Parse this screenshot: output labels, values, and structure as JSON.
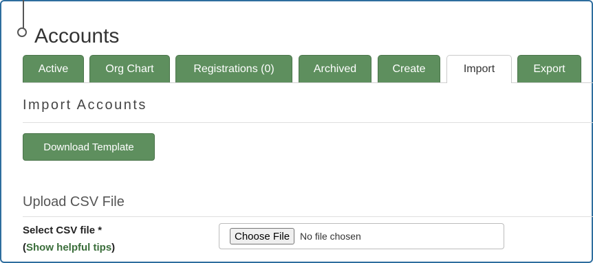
{
  "page": {
    "title": "Accounts"
  },
  "tabs": [
    {
      "label": "Active",
      "active": false
    },
    {
      "label": "Org Chart",
      "active": false
    },
    {
      "label": "Registrations (0)",
      "active": false
    },
    {
      "label": "Archived",
      "active": false
    },
    {
      "label": "Create",
      "active": false
    },
    {
      "label": "Import",
      "active": true
    },
    {
      "label": "Export",
      "active": false
    }
  ],
  "import_section": {
    "heading": "Import Accounts",
    "download_button": "Download Template"
  },
  "upload_section": {
    "heading": "Upload CSV File",
    "field_label": "Select CSV file *",
    "tips_open": "(",
    "tips_link": "Show helpful tips",
    "tips_close": ")",
    "choose_button": "Choose File",
    "file_status": "No file chosen"
  },
  "colors": {
    "tab_green": "#5e8f5e",
    "frame_blue": "#2e6d9e",
    "link_green": "#3b6e3b"
  }
}
